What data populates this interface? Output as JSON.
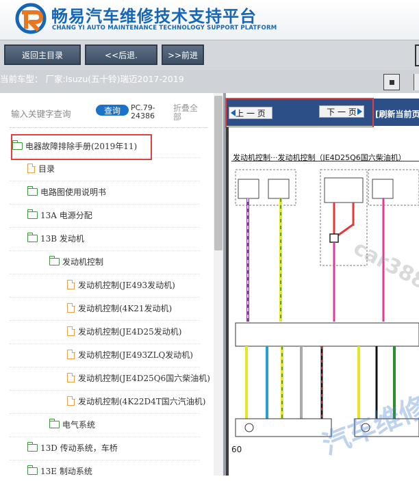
{
  "header": {
    "title_cn": "畅易汽车维修技术支持平台",
    "title_en": "CHANG YI AUTO MAINTENANCE TECHNOLOGY SUPPORT PLATFORM",
    "logo": "chang-yi-logo"
  },
  "nav": {
    "home_label": "返回主目录",
    "back_label": "<<后退.",
    "forward_label": ">>前进"
  },
  "model_bar": {
    "text": "当前车型： 厂家:Isuzu(五十铃)瑞迈2017-2019"
  },
  "search": {
    "label": "输入关键字查询",
    "button": "查询",
    "code": "PC.79-24386",
    "collapse": "折叠全部"
  },
  "tree": {
    "items": [
      {
        "label": "电器故障排除手册(2019年11)",
        "icon": "folder-open-icon"
      },
      {
        "label": "目录",
        "icon": "document-icon"
      },
      {
        "label": "电路图使用说明书",
        "icon": "folder-icon"
      },
      {
        "label": "13A 电源分配",
        "icon": "folder-icon"
      },
      {
        "label": "13B 发动机",
        "icon": "folder-open-icon"
      },
      {
        "label": "发动机控制",
        "icon": "folder-open-icon"
      },
      {
        "label": "发动机控制(JE493发动机)",
        "icon": "document-icon"
      },
      {
        "label": "发动机控制(4K21发动机)",
        "icon": "document-icon"
      },
      {
        "label": "发动机控制(JE4D25发动机)",
        "icon": "document-icon"
      },
      {
        "label": "发动机控制(JE493ZLQ发动机)",
        "icon": "document-icon"
      },
      {
        "label": "发动机控制(JE4D25Q6国六柴油机)",
        "icon": "document-icon"
      },
      {
        "label": "发动机控制(4K22D4T国六汽油机)",
        "icon": "document-icon"
      },
      {
        "label": "电气系统",
        "icon": "folder-icon"
      },
      {
        "label": "13D 传动系统，车桥",
        "icon": "folder-icon"
      },
      {
        "label": "13E 制动系统",
        "icon": "folder-icon"
      }
    ]
  },
  "viewer": {
    "prev_page": "上 一 页",
    "next_page": "下 一 页",
    "refresh": "[刷新当前页",
    "diagram_title": "发动机控制···发动机控制（JE4D25Q6国六柴油机）",
    "page_number": "60",
    "watermark_1": "car388",
    "watermark_2": "汽车维修"
  },
  "colors": {
    "brand_blue": "#1466b8",
    "highlight_red": "#e04040",
    "nav_button": "#4a5d72",
    "page_nav_bg": "#2b4f86"
  }
}
